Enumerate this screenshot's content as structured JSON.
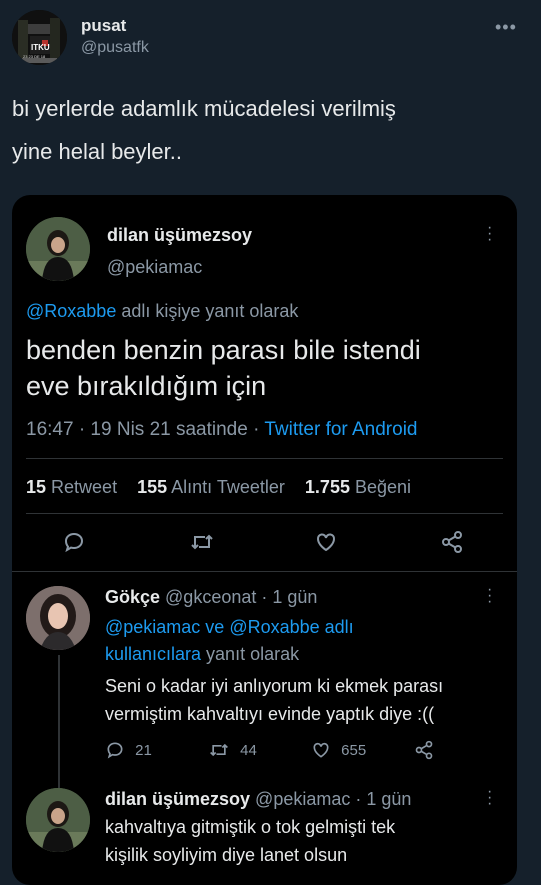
{
  "outer": {
    "display_name": "pusat",
    "handle": "@pusatfk",
    "text_line1": "bi yerlerde adamlık mücadelesi verilmiş",
    "text_line2": "yine helal beyler..",
    "avatar_text": "ITKU",
    "avatar_sub": "23 23 DE 18"
  },
  "quoted": {
    "display_name": "dilan üşümezsoy",
    "handle": "@pekiamac",
    "reply_to_handle": "@Roxabbe",
    "reply_to_suffix": " adlı kişiye yanıt olarak",
    "text_line1": "benden benzin parası bile istendi",
    "text_line2": "eve bırakıldığım için",
    "timestamp": "16:47 · 19 Nis 21 saatinde · ",
    "source": "Twitter for Android",
    "stats": {
      "retweets_count": "15",
      "retweets_label": " Retweet",
      "quotes_count": "155",
      "quotes_label": " Alıntı Tweetler",
      "likes_count": "1.755",
      "likes_label": " Beğeni"
    }
  },
  "replies": [
    {
      "display_name": "Gökçe",
      "handle_time": " @gkceonat · 1 gün",
      "reply_line1_links": "@pekiamac ve @Roxabbe adlı",
      "reply_line2_link": "kullanıcılara",
      "reply_line2_suffix": " yanıt olarak",
      "text_line1": "Seni o kadar iyi anlıyorum ki ekmek parası",
      "text_line2": "vermiştim kahvaltıyı evinde yaptık diye :((",
      "reply_count": "21",
      "retweet_count": "44",
      "like_count": "655"
    },
    {
      "display_name": "dilan üşümezsoy",
      "handle_time": " @pekiamac · 1 gün",
      "text_line1": "kahvaltıya gitmiştik o tok gelmişti tek",
      "text_line2": "kişilik soyliyim diye lanet olsun"
    }
  ],
  "colors": {
    "background": "#15202b",
    "card": "#000000",
    "link": "#1d9bf0",
    "muted": "#8b98a5"
  }
}
